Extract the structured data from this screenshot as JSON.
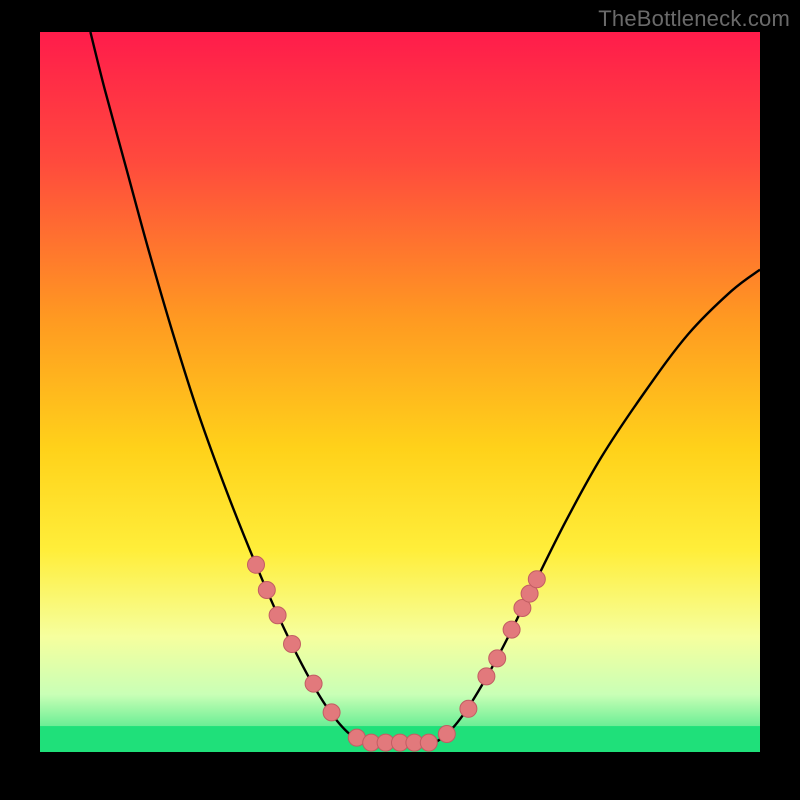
{
  "watermark": "TheBottleneck.com",
  "colors": {
    "marker_fill": "#e2797c",
    "marker_stroke": "#c25d63",
    "curve": "#000000",
    "green_band": "#1fe07a",
    "background_black": "#000000"
  },
  "chart_data": {
    "type": "line",
    "title": "",
    "xlabel": "",
    "ylabel": "",
    "xlim": [
      0,
      100
    ],
    "ylim": [
      0,
      100
    ],
    "gradient_stops": [
      {
        "offset": 0,
        "color": "#ff1c4b"
      },
      {
        "offset": 18,
        "color": "#ff4a3d"
      },
      {
        "offset": 40,
        "color": "#ff9a21"
      },
      {
        "offset": 58,
        "color": "#ffd21a"
      },
      {
        "offset": 72,
        "color": "#ffee3a"
      },
      {
        "offset": 84,
        "color": "#f6ff9e"
      },
      {
        "offset": 92,
        "color": "#c9ffb6"
      },
      {
        "offset": 100,
        "color": "#1fe07a"
      }
    ],
    "curve_points": [
      {
        "x": 7.0,
        "y": 100.0
      },
      {
        "x": 9.0,
        "y": 92.0
      },
      {
        "x": 12.0,
        "y": 81.0
      },
      {
        "x": 15.0,
        "y": 70.0
      },
      {
        "x": 18.5,
        "y": 58.0
      },
      {
        "x": 22.0,
        "y": 47.0
      },
      {
        "x": 26.0,
        "y": 36.0
      },
      {
        "x": 30.0,
        "y": 26.0
      },
      {
        "x": 33.5,
        "y": 18.0
      },
      {
        "x": 37.0,
        "y": 11.0
      },
      {
        "x": 40.0,
        "y": 6.0
      },
      {
        "x": 43.0,
        "y": 2.5
      },
      {
        "x": 46.0,
        "y": 1.0
      },
      {
        "x": 50.0,
        "y": 1.0
      },
      {
        "x": 54.0,
        "y": 1.0
      },
      {
        "x": 57.0,
        "y": 3.0
      },
      {
        "x": 60.0,
        "y": 7.0
      },
      {
        "x": 64.0,
        "y": 14.0
      },
      {
        "x": 68.0,
        "y": 22.0
      },
      {
        "x": 73.0,
        "y": 32.0
      },
      {
        "x": 78.0,
        "y": 41.0
      },
      {
        "x": 84.0,
        "y": 50.0
      },
      {
        "x": 90.0,
        "y": 58.0
      },
      {
        "x": 96.0,
        "y": 64.0
      },
      {
        "x": 100.0,
        "y": 67.0
      }
    ],
    "markers": [
      {
        "x": 30.0,
        "y": 26.0
      },
      {
        "x": 31.5,
        "y": 22.5
      },
      {
        "x": 33.0,
        "y": 19.0
      },
      {
        "x": 35.0,
        "y": 15.0
      },
      {
        "x": 38.0,
        "y": 9.5
      },
      {
        "x": 40.5,
        "y": 5.5
      },
      {
        "x": 44.0,
        "y": 2.0
      },
      {
        "x": 46.0,
        "y": 1.3
      },
      {
        "x": 48.0,
        "y": 1.3
      },
      {
        "x": 50.0,
        "y": 1.3
      },
      {
        "x": 52.0,
        "y": 1.3
      },
      {
        "x": 54.0,
        "y": 1.3
      },
      {
        "x": 56.5,
        "y": 2.5
      },
      {
        "x": 59.5,
        "y": 6.0
      },
      {
        "x": 62.0,
        "y": 10.5
      },
      {
        "x": 63.5,
        "y": 13.0
      },
      {
        "x": 65.5,
        "y": 17.0
      },
      {
        "x": 67.0,
        "y": 20.0
      },
      {
        "x": 68.0,
        "y": 22.0
      },
      {
        "x": 69.0,
        "y": 24.0
      }
    ],
    "green_band_y_range": [
      0,
      3.6
    ]
  }
}
